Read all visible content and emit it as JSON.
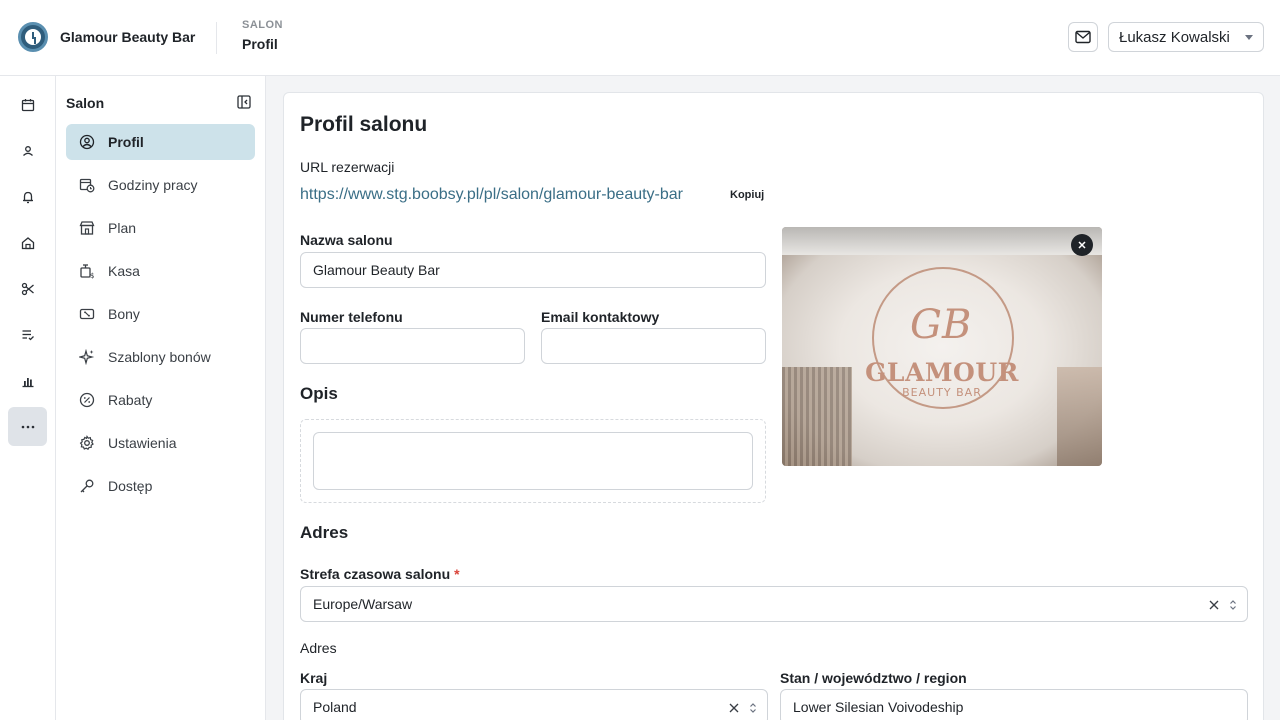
{
  "header": {
    "app_title": "Glamour Beauty Bar",
    "breadcrumb_section": "SALON",
    "breadcrumb_page": "Profil",
    "user_name": "Łukasz Kowalski"
  },
  "rail": {
    "items": [
      "calendar-icon",
      "clients-icon",
      "bell-icon",
      "home-icon",
      "scissors-icon",
      "checklist-icon",
      "chart-icon",
      "more-icon"
    ],
    "active": "more-icon"
  },
  "sidenav": {
    "title": "Salon",
    "items": [
      {
        "label": "Profil",
        "icon": "user-circle-icon",
        "active": true
      },
      {
        "label": "Godziny pracy",
        "icon": "calendar-clock-icon",
        "active": false
      },
      {
        "label": "Plan",
        "icon": "store-icon",
        "active": false
      },
      {
        "label": "Kasa",
        "icon": "cash-register-icon",
        "active": false
      },
      {
        "label": "Bony",
        "icon": "voucher-icon",
        "active": false
      },
      {
        "label": "Szablony bonów",
        "icon": "sparkles-icon",
        "active": false
      },
      {
        "label": "Rabaty",
        "icon": "percent-icon",
        "active": false
      },
      {
        "label": "Ustawienia",
        "icon": "gear-icon",
        "active": false
      },
      {
        "label": "Dostęp",
        "icon": "key-icon",
        "active": false
      }
    ]
  },
  "profile": {
    "title": "Profil salonu",
    "url_label": "URL rezerwacji",
    "url_value": "https://www.stg.boobsy.pl/pl/salon/glamour-beauty-bar",
    "copy_label": "Kopiuj",
    "name_label": "Nazwa salonu",
    "name_value": "Glamour Beauty Bar",
    "phone_label": "Numer telefonu",
    "phone_value": "",
    "email_label": "Email kontaktowy",
    "email_value": "",
    "description_heading": "Opis",
    "description_value": "",
    "logo_text": "GLAMOUR",
    "logo_subtext": "BEAUTY BAR",
    "logo_monogram": "GB"
  },
  "address": {
    "heading": "Adres",
    "timezone_label": "Strefa czasowa salonu",
    "required_mark": "*",
    "timezone_value": "Europe/Warsaw",
    "sub_heading": "Adres",
    "country_label": "Kraj",
    "country_value": "Poland",
    "region_label": "Stan / województwo / region",
    "region_value": "Lower Silesian Voivodeship"
  },
  "colors": {
    "accent": "#3a6e86",
    "active_nav": "#cde2ea",
    "required": "#d9443a"
  }
}
